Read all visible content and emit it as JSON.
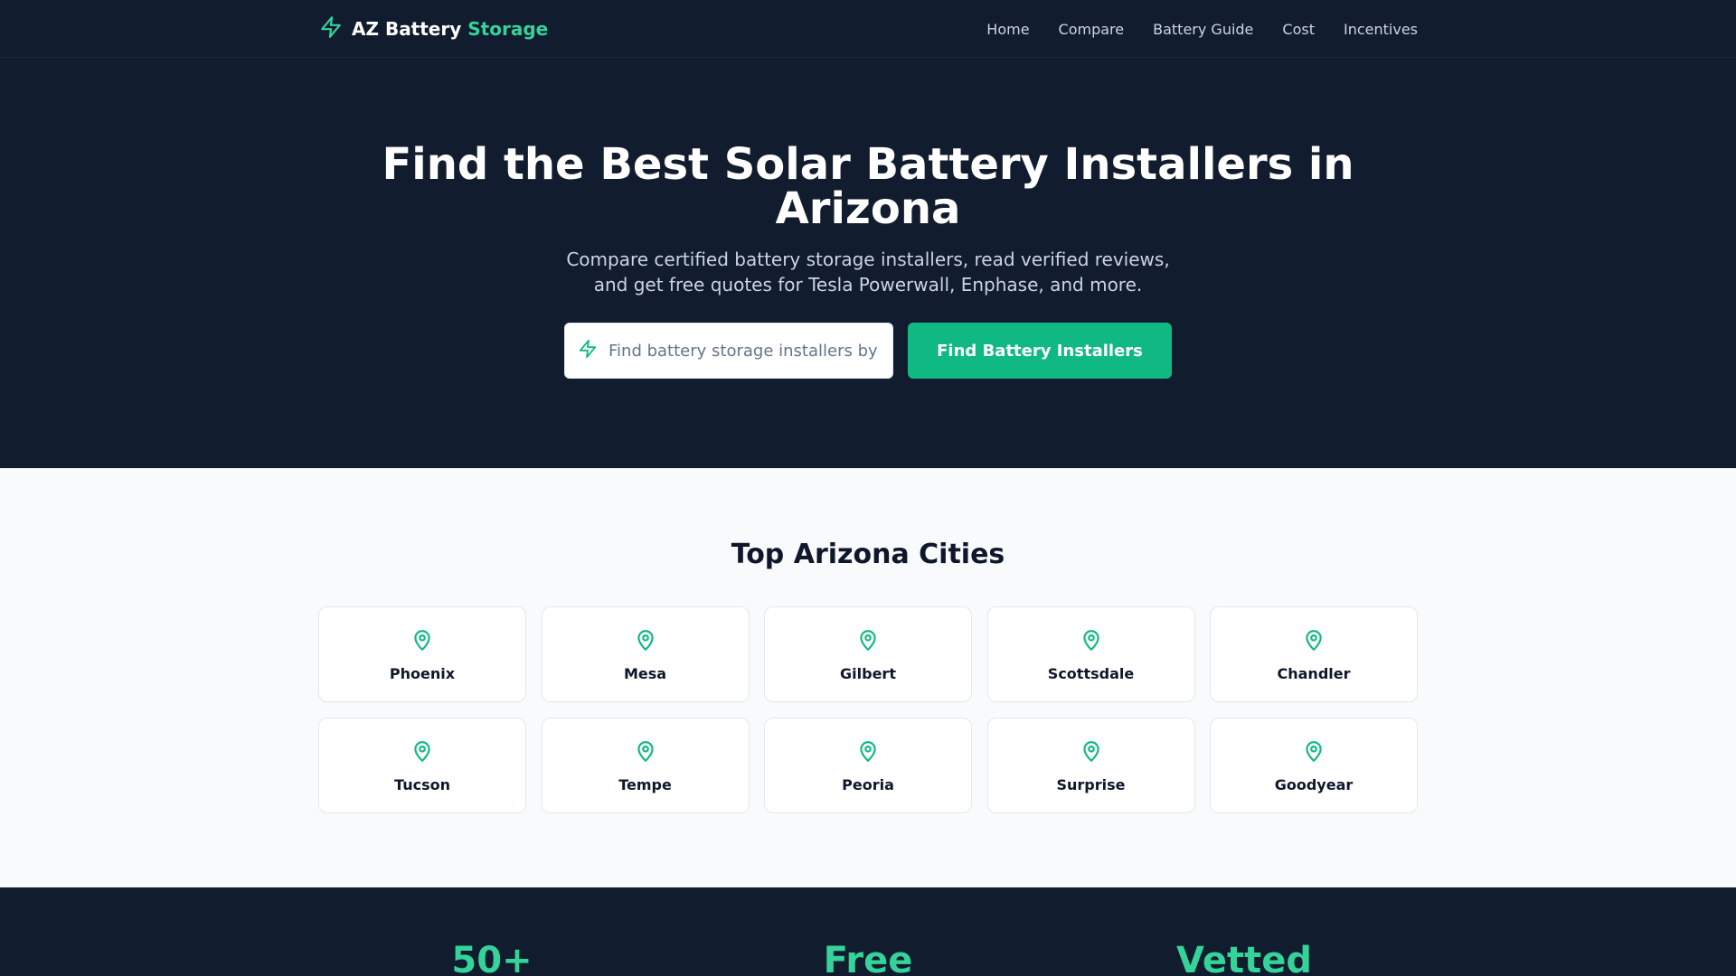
{
  "brand": {
    "name": "AZ Battery",
    "accent": "Storage"
  },
  "nav": {
    "links": [
      "Home",
      "Compare",
      "Battery Guide",
      "Cost",
      "Incentives"
    ]
  },
  "hero": {
    "title": "Find the Best Solar Battery Installers in Arizona",
    "subtitle": "Compare certified battery storage installers, read verified reviews, and get free quotes for Tesla Powerwall, Enphase, and more.",
    "search_placeholder": "Find battery storage installers by",
    "search_button": "Find Battery Installers"
  },
  "cities": {
    "heading": "Top Arizona Cities",
    "items": [
      "Phoenix",
      "Mesa",
      "Gilbert",
      "Scottsdale",
      "Chandler",
      "Tucson",
      "Tempe",
      "Peoria",
      "Surprise",
      "Goodyear"
    ]
  },
  "stats": {
    "items": [
      "50+",
      "Free",
      "Vetted"
    ]
  },
  "colors": {
    "dark": "#111c2e",
    "accent": "#10b981",
    "accent_light": "#34d399"
  },
  "icons": {
    "brand": "bolt-icon",
    "search": "bolt-icon",
    "city": "map-pin-icon"
  }
}
